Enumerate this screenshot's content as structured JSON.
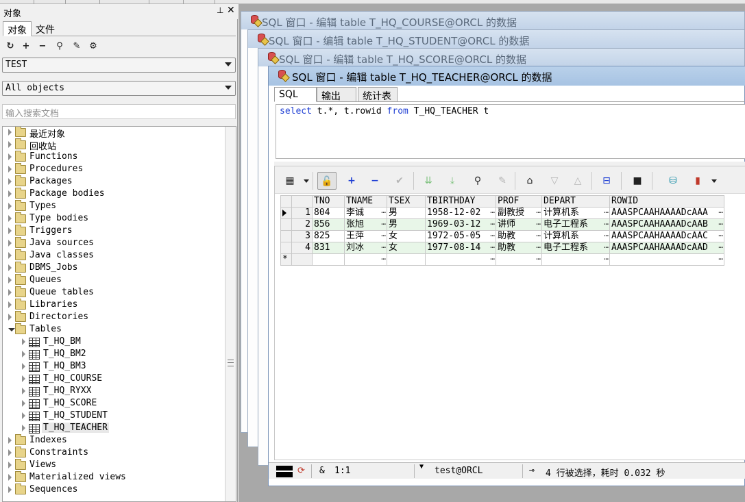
{
  "left_panel": {
    "title": "对象",
    "pin_glyph": "⊥",
    "close_glyph": "✕",
    "tabs": [
      "对象",
      "文件"
    ],
    "toolbar": [
      "↻",
      "+",
      "−",
      "⚲",
      "✎",
      "⚙"
    ],
    "user_combo": "TEST",
    "filter_combo": "All objects",
    "search_placeholder": "输入搜索文档",
    "tree": {
      "folders_top": [
        "最近对象",
        "回收站",
        "Functions",
        "Procedures",
        "Packages",
        "Package bodies",
        "Types",
        "Type bodies",
        "Triggers",
        "Java sources",
        "Java classes",
        "DBMS_Jobs",
        "Queues",
        "Queue tables",
        "Libraries",
        "Directories"
      ],
      "tables_label": "Tables",
      "tables": [
        "T_HQ_BM",
        "T_HQ_BM2",
        "T_HQ_BM3",
        "T_HQ_COURSE",
        "T_HQ_RYXX",
        "T_HQ_SCORE",
        "T_HQ_STUDENT",
        "T_HQ_TEACHER"
      ],
      "folders_bottom": [
        "Indexes",
        "Constraints",
        "Views",
        "Materialized views",
        "Sequences"
      ]
    }
  },
  "windows": {
    "bg": [
      "SQL 窗口 - 编辑 table T_HQ_COURSE@ORCL 的数据",
      "SQL 窗口 - 编辑 table T_HQ_STUDENT@ORCL 的数据",
      "SQL 窗口 - 编辑 table T_HQ_SCORE@ORCL 的数据"
    ],
    "active_title": "SQL 窗口 - 编辑 table T_HQ_TEACHER@ORCL 的数据"
  },
  "sql_window": {
    "tabs": [
      "SQL",
      "输出",
      "统计表"
    ],
    "query": {
      "kw1": "select",
      "part1": " t.*, t.rowid ",
      "kw2": "from",
      "part2": " T_HQ_TEACHER t"
    },
    "grid": {
      "columns": [
        "TNO",
        "TNAME",
        "TSEX",
        "TBIRTHDAY",
        "PROF",
        "DEPART",
        "ROWID"
      ],
      "rows": [
        {
          "num": "1",
          "cells": [
            "804",
            "李诚",
            "男",
            "1958-12-02",
            "副教授",
            "计算机系",
            "AAASPCAAHAAAADcAAA"
          ]
        },
        {
          "num": "2",
          "cells": [
            "856",
            "张旭",
            "男",
            "1969-03-12",
            "讲师",
            "电子工程系",
            "AAASPCAAHAAAADcAAB"
          ]
        },
        {
          "num": "3",
          "cells": [
            "825",
            "王萍",
            "女",
            "1972-05-05",
            "助教",
            "计算机系",
            "AAASPCAAHAAAADcAAC"
          ]
        },
        {
          "num": "4",
          "cells": [
            "831",
            "刘冰",
            "女",
            "1977-08-14",
            "助教",
            "电子工程系",
            "AAASPCAAHAAAADcAAD"
          ]
        }
      ],
      "new_row_marker": "*",
      "ellipsis": "…"
    },
    "status": {
      "amp": "&",
      "position": "1:1",
      "connection": "test@ORCL",
      "message": "4 行被选择，耗时 0.032 秒"
    }
  },
  "colors": {
    "active_title_bg": "#b9d1ea",
    "keyword": "#1f3fd4",
    "alt_row": "#e8f6e8"
  }
}
